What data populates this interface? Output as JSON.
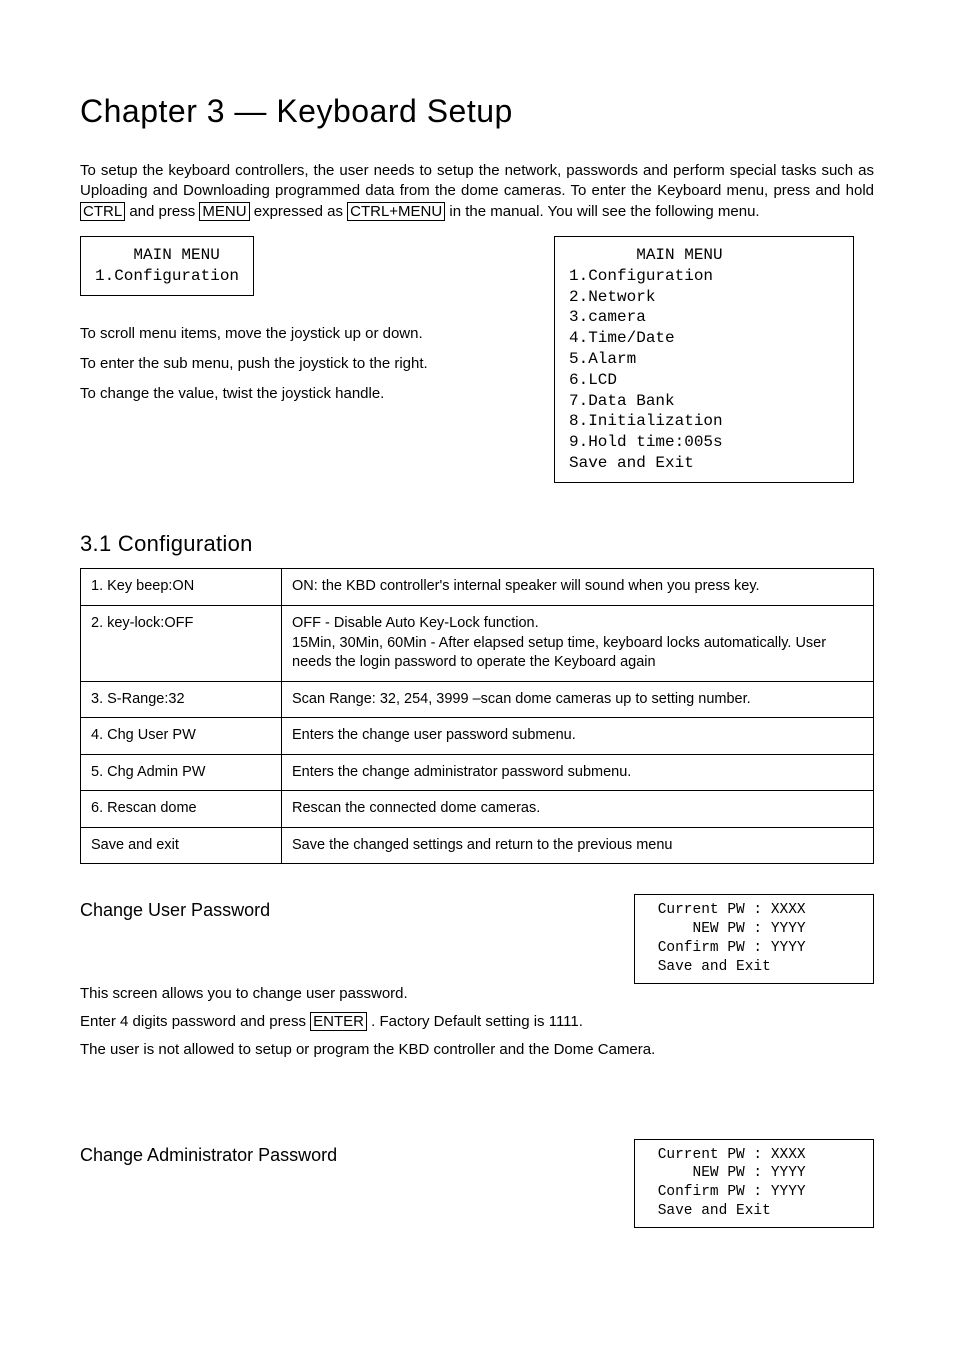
{
  "chapter_title": "Chapter 3 — Keyboard Setup",
  "intro": {
    "part1": "To setup the keyboard controllers, the user needs to setup the network, passwords and perform special tasks such as Uploading and Downloading programmed data from the dome cameras. To enter the Keyboard menu, press and hold ",
    "key1": "CTRL",
    "mid1": " and press ",
    "key2": "MENU",
    "mid2": " expressed as ",
    "key3": "CTRL+MENU",
    "end": " in the manual. You will see the following menu."
  },
  "lcd_left": "    MAIN MENU\n1.Configuration",
  "instructions": {
    "i1": "To scroll menu items, move the joystick up or down.",
    "i2": "To enter the sub menu, push the joystick to the right.",
    "i3": "To change the value, twist the joystick handle."
  },
  "lcd_right": "       MAIN MENU\n1.Configuration\n2.Network\n3.camera\n4.Time/Date\n5.Alarm\n6.LCD\n7.Data Bank\n8.Initialization\n9.Hold time:005s\nSave and Exit",
  "section_title": "3.1 Configuration",
  "config_table": {
    "r1k": "1. Key beep:ON",
    "r1v": "ON: the KBD controller's internal speaker will sound when you press key.",
    "r2k": "2. key-lock:OFF",
    "r2v": "OFF - Disable Auto Key-Lock function.\n15Min, 30Min, 60Min - After elapsed setup time, keyboard locks automatically. User needs the login password to operate the Keyboard again",
    "r3k": "3. S-Range:32",
    "r3v": "Scan Range: 32, 254, 3999 –scan dome cameras up to setting number.",
    "r4k": "4. Chg User PW",
    "r4v": "Enters the change user password submenu.",
    "r5k": "5. Chg Admin PW",
    "r5v": "Enters the change administrator password submenu.",
    "r6k": "6. Rescan dome",
    "r6v": "Rescan the connected dome cameras.",
    "r7k": "Save and exit",
    "r7v": "Save the changed settings and return to the previous menu"
  },
  "user_pw": {
    "heading": "Change User Password",
    "lcd": " Current PW : XXXX\n     NEW PW : YYYY\n Confirm PW : YYYY\n Save and Exit",
    "l1": "This screen allows you to change user password.",
    "l2a": "Enter 4 digits password and press ",
    "key": "ENTER",
    "l2b": " . Factory Default setting is 1111.",
    "l3": "The user is not allowed to setup or program the KBD controller and the Dome Camera."
  },
  "admin_pw": {
    "heading": "Change Administrator Password",
    "lcd": " Current PW : XXXX\n     NEW PW : YYYY\n Confirm PW : YYYY\n Save and Exit"
  }
}
